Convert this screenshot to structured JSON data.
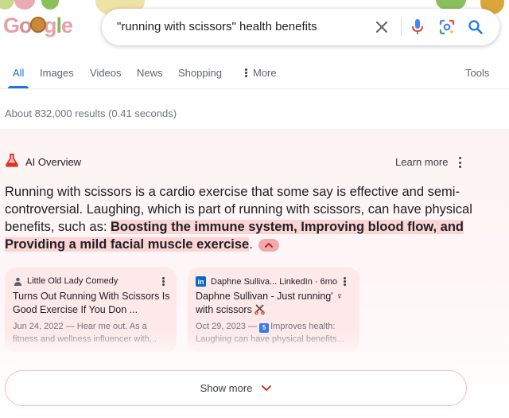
{
  "header": {
    "logo_letters": [
      "G",
      "o",
      "o",
      "g",
      "l",
      "e"
    ],
    "search_query": "\"running with scissors\" health benefits",
    "clear_icon": "close-icon",
    "voice_icon": "mic-icon",
    "lens_icon": "camera-icon",
    "search_icon": "search-icon"
  },
  "tabs": {
    "items": [
      {
        "label": "All",
        "active": true
      },
      {
        "label": "Images"
      },
      {
        "label": "Videos"
      },
      {
        "label": "News"
      },
      {
        "label": "Shopping"
      },
      {
        "label": "More"
      }
    ],
    "tools_label": "Tools"
  },
  "results_stats": "About 832,000 results (0.41 seconds)",
  "ai_overview": {
    "title": "AI Overview",
    "learn_more": "Learn more",
    "body_plain": "Running with scissors is a cardio exercise that some say is effective and semi-controversial. Laughing, which is part of running with scissors, can have physical benefits, such as: ",
    "body_highlight": "Boosting the immune system, Improving blood flow, and Providing a mild facial muscle exercise",
    "body_end": ".",
    "accent_color": "#d93025",
    "highlight_color": "#fbd4d6"
  },
  "sources": [
    {
      "source": "Little Old Lady Comedy",
      "title": "Turns Out Running With Scissors Is Good Exercise If You Don ...",
      "date": "Jun 24, 2022",
      "snippet": "— Hear me out. As a fitness and wellness influencer with..."
    },
    {
      "source": "Daphne Sulliva... LinkedIn · 6mo",
      "title": "Daphne Sullivan - Just running' ♀ with scissors",
      "date": "Oct 29, 2023",
      "badge": "5",
      "snippet": "Improves health: Laughing can have physical benefits..."
    }
  ],
  "show_more": "Show more"
}
